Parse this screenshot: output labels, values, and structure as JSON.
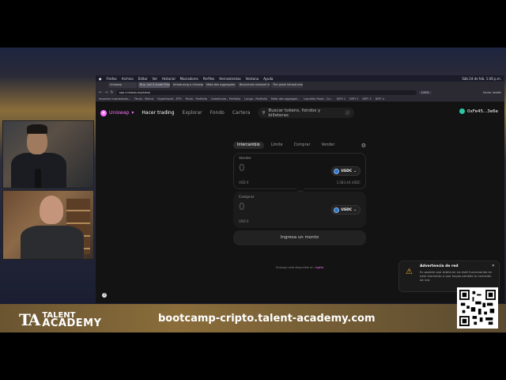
{
  "menubar": {
    "items": [
      "Firefox",
      "Archivo",
      "Editar",
      "Ver",
      "Historial",
      "Marcadores",
      "Perfiles",
      "Herramientas",
      "Ventana",
      "Ayuda"
    ],
    "status": "Sáb 24 de feb. 1:46 p.m."
  },
  "tabs": [
    {
      "label": "Uniswap",
      "active": false
    },
    {
      "label": "Buy, sell & trade Ethereum and other...",
      "active": true
    },
    {
      "label": "Introducing a Uniswap v4...",
      "active": false
    },
    {
      "label": "Meta dex aggregator - DeFiLlama",
      "active": false
    },
    {
      "label": "Blockchain network fees",
      "active": false
    },
    {
      "label": "The great infrastructure...",
      "active": false
    }
  ],
  "urlbar": {
    "url": "app.uniswap.org/swap",
    "zoom": "120%",
    "account": "Iniciar sesión"
  },
  "bookmarks": [
    "Importar marcadores...",
    "Paulo - Mamá",
    "Hyperliquid - ETH",
    "Paulo - Portfolio",
    "Coberturas - Portfolio",
    "Lunga - Portfolio",
    "Meta dex aggregat...",
    "Liquidity Pools - Co...",
    "DEFI 1",
    "DEFI 2",
    "DEFI 3",
    "DEFI 4"
  ],
  "app": {
    "logo": "Uniswap",
    "nav": [
      "Hacer trading",
      "Explorar",
      "Fondo",
      "Cartera"
    ],
    "search_placeholder": "Buscar tokens, fondos y billeteras",
    "search_key": "/",
    "wallet": "0xFe45...3e6e"
  },
  "swap": {
    "tabs": [
      "Intercambio",
      "Límite",
      "Comprar",
      "Vender"
    ],
    "sell": {
      "label": "Vender",
      "amount": "0",
      "usd": "USD 0",
      "token": "USDC",
      "balance": "1,583.44 USDC"
    },
    "buy": {
      "label": "Comprar",
      "amount": "0",
      "usd": "USD 0",
      "token": "USDC"
    },
    "cta": "Ingresa un monto"
  },
  "footer_note": {
    "text": "Uniswap está disponible en:",
    "link": "Inglés"
  },
  "toast": {
    "title": "Advertencia de red",
    "body": "Es posible que Arbitrum no esté funcionando en este momento o que hayas perdido la conexión de red."
  },
  "banner": {
    "brand_mark": "TA",
    "brand_line1": "TALENT",
    "brand_line2": "ACADEMY",
    "website": "bootcamp-cripto.talent-academy.com"
  },
  "colors": {
    "accent": "#fc72ff",
    "usdc": "#2775ca",
    "warning": "#f3b71e",
    "banner": "#8a6d3a"
  }
}
